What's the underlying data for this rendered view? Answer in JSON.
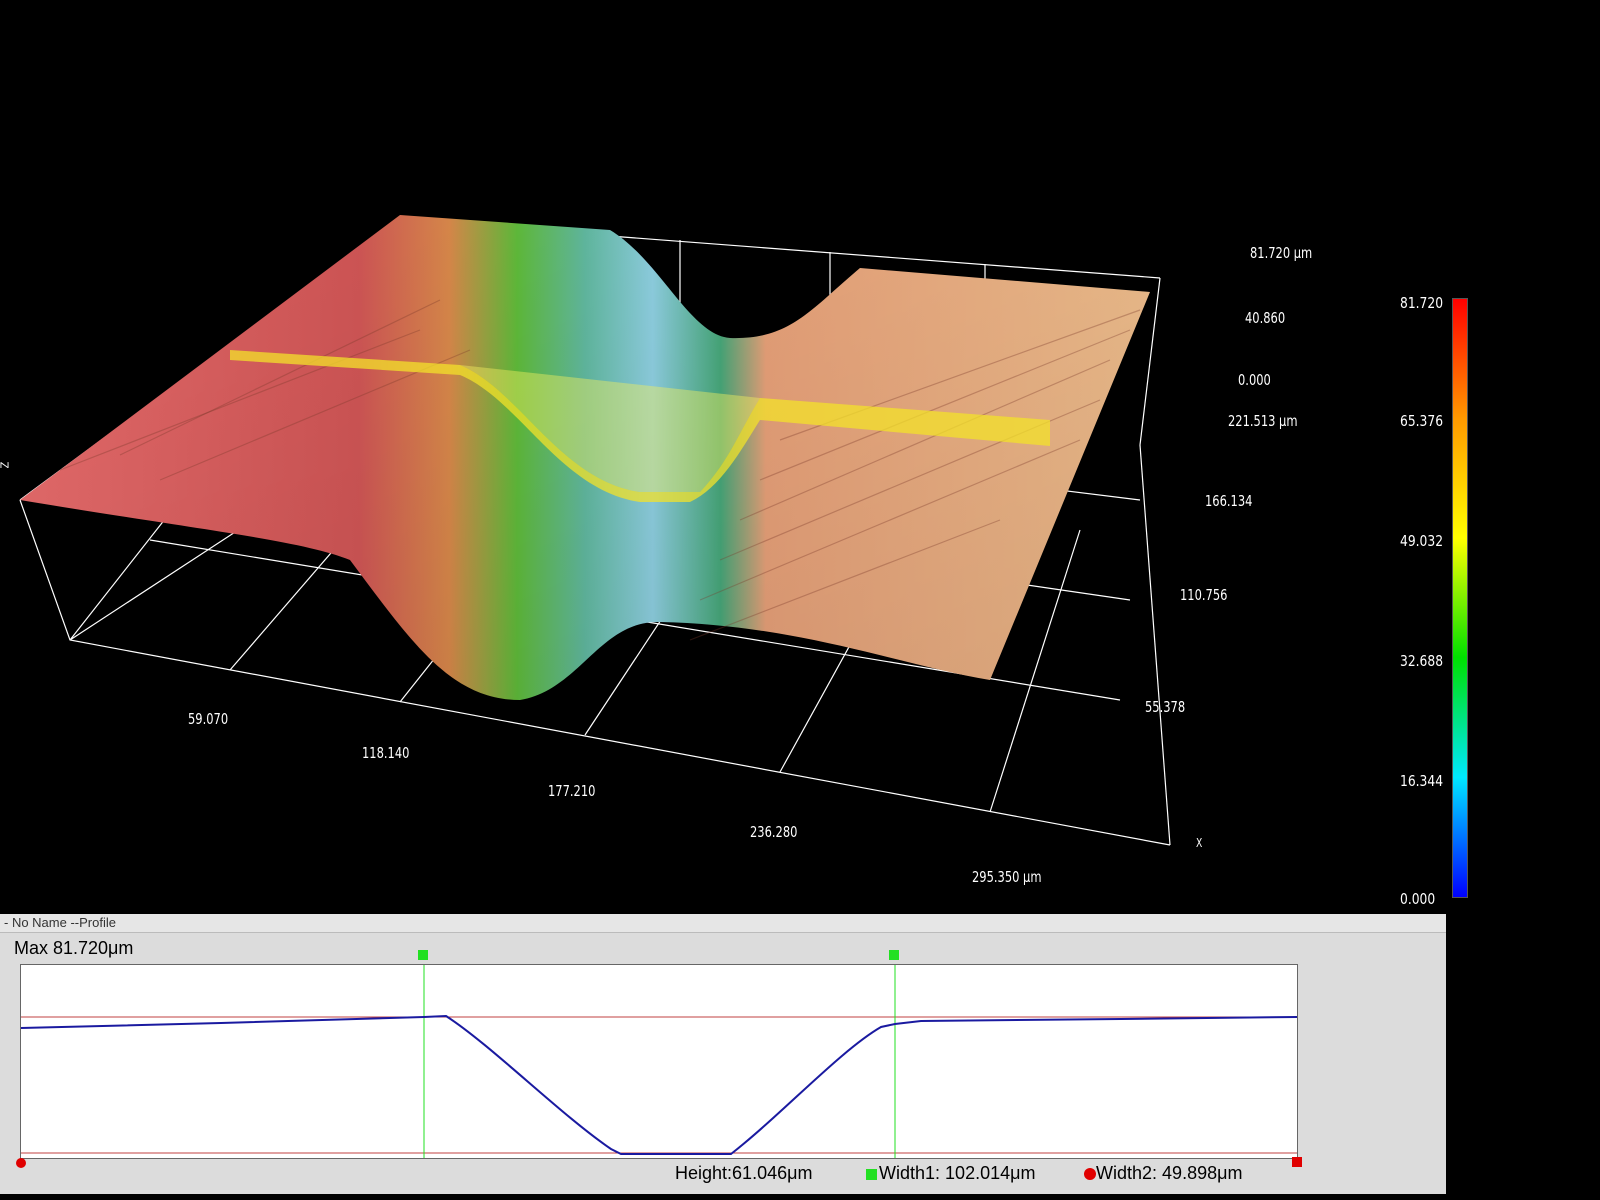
{
  "view3d": {
    "z_axis_labels": [
      "81.720 μm",
      "40.860",
      "0.000"
    ],
    "y_axis_labels": [
      "221.513 μm",
      "166.134",
      "110.756",
      "55.378"
    ],
    "x_axis_labels": [
      "59.070",
      "118.140",
      "177.210",
      "236.280",
      "295.350 μm"
    ],
    "x_axis_name": "X",
    "z_axis_name": "Z"
  },
  "colorbar": {
    "labels": [
      "81.720",
      "65.376",
      "49.032",
      "32.688",
      "16.344",
      "0.000"
    ],
    "colors": [
      "#ff0000",
      "#ff9900",
      "#ffff00",
      "#00e000",
      "#00e8ff",
      "#0000ff"
    ]
  },
  "profile_panel": {
    "title": "- No Name --Profile",
    "max_label": "Max  81.720μm",
    "height_label": "Height:",
    "height_value": "61.046μm",
    "width1_label": "Width1:",
    "width1_value": "102.014μm",
    "width2_label": "Width2:",
    "width2_value": "49.898μm"
  },
  "colors": {
    "profile_line": "#1a1aa0",
    "reference_line": "#c04040",
    "marker_green": "#22e022",
    "marker_red": "#e00000"
  }
}
